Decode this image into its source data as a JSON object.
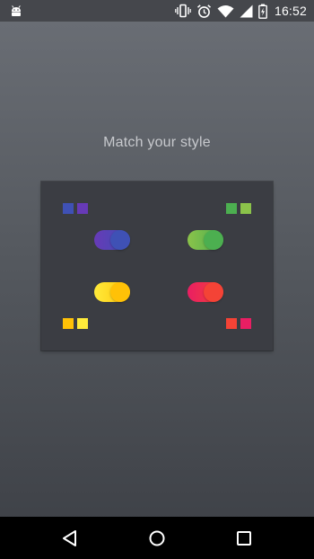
{
  "status_bar": {
    "time": "16:52",
    "icons": [
      "android-debug-icon",
      "vibrate-icon",
      "alarm-icon",
      "wifi-icon",
      "signal-icon",
      "battery-icon"
    ]
  },
  "main": {
    "title": "Match your style"
  },
  "style_options": [
    {
      "name": "indigo-purple",
      "colors": [
        "#3f51b5",
        "#673ab7"
      ],
      "toggle_from": "#673ab7",
      "toggle_to": "#3f51b5"
    },
    {
      "name": "green-lightgreen",
      "colors": [
        "#4caf50",
        "#8bc34a"
      ],
      "toggle_from": "#8bc34a",
      "toggle_to": "#4caf50"
    },
    {
      "name": "amber-yellow",
      "colors": [
        "#ffc107",
        "#ffeb3b"
      ],
      "toggle_from": "#ffeb3b",
      "toggle_to": "#ffc107"
    },
    {
      "name": "red-pink",
      "colors": [
        "#f44336",
        "#e91e63"
      ],
      "toggle_from": "#e91e63",
      "toggle_to": "#f44336"
    }
  ],
  "nav_bar": {
    "icons": [
      "back-icon",
      "home-icon",
      "recents-icon"
    ]
  }
}
